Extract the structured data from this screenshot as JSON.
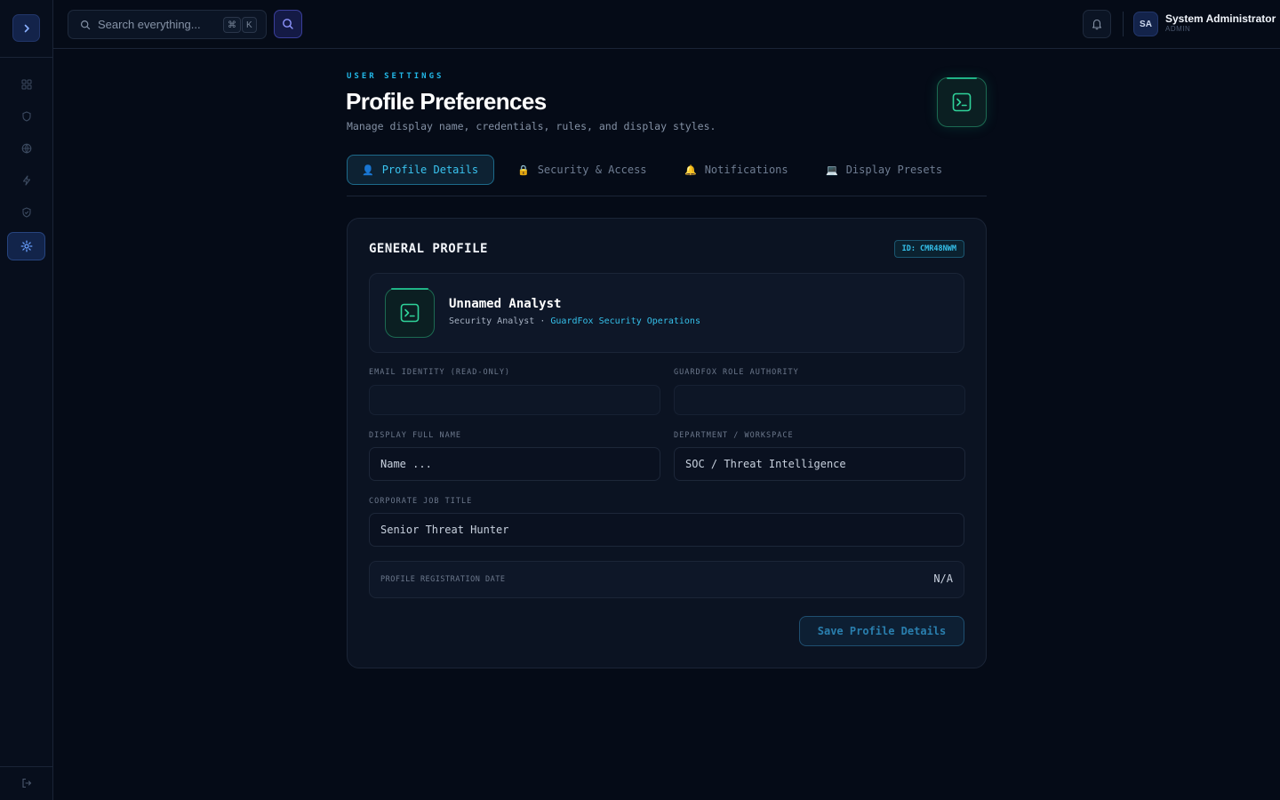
{
  "sidebar": {
    "toggle_icon": "chevron-right-icon",
    "items": [
      {
        "icon": "dashboard-grid-icon"
      },
      {
        "icon": "shield-icon"
      },
      {
        "icon": "globe-icon"
      },
      {
        "icon": "lightning-icon"
      },
      {
        "icon": "shield-check-icon"
      },
      {
        "icon": "gear-icon",
        "active": true
      }
    ],
    "logout_icon": "logout-icon"
  },
  "topbar": {
    "search": {
      "placeholder": "Search everything...",
      "shortcut_mod": "⌘",
      "shortcut_key": "K"
    },
    "user": {
      "initials": "SA",
      "name": "System Administrator",
      "role": "ADMIN"
    }
  },
  "header": {
    "eyebrow": "USER SETTINGS",
    "title": "Profile Preferences",
    "subtitle": "Manage display name, credentials, rules, and display styles."
  },
  "tabs": [
    {
      "emoji": "👤",
      "label": "Profile Details",
      "active": true
    },
    {
      "emoji": "🔒",
      "label": "Security & Access"
    },
    {
      "emoji": "🔔",
      "label": "Notifications"
    },
    {
      "emoji": "💻",
      "label": "Display Presets"
    }
  ],
  "card": {
    "title": "GENERAL PROFILE",
    "id_badge": "ID: CMR48NWM",
    "profile": {
      "name": "Unnamed Analyst",
      "role": "Security Analyst",
      "separator": " · ",
      "org": "GuardFox Security Operations"
    },
    "fields": {
      "email_label": "EMAIL IDENTITY (READ-ONLY)",
      "email_value": "",
      "role_label": "GUARDFOX ROLE AUTHORITY",
      "role_value": "",
      "name_label": "DISPLAY FULL NAME",
      "name_placeholder": "Name ...",
      "dept_label": "DEPARTMENT / WORKSPACE",
      "dept_value": "SOC / Threat Intelligence",
      "title_label": "CORPORATE JOB TITLE",
      "title_value": "Senior Threat Hunter"
    },
    "registration": {
      "label": "PROFILE REGISTRATION DATE",
      "value": "N/A"
    },
    "save_label": "Save Profile Details"
  },
  "colors": {
    "background": "#050b17",
    "accent_cyan": "#22b8e8",
    "accent_green": "#20b386",
    "accent_indigo": "#3a3f9a"
  }
}
